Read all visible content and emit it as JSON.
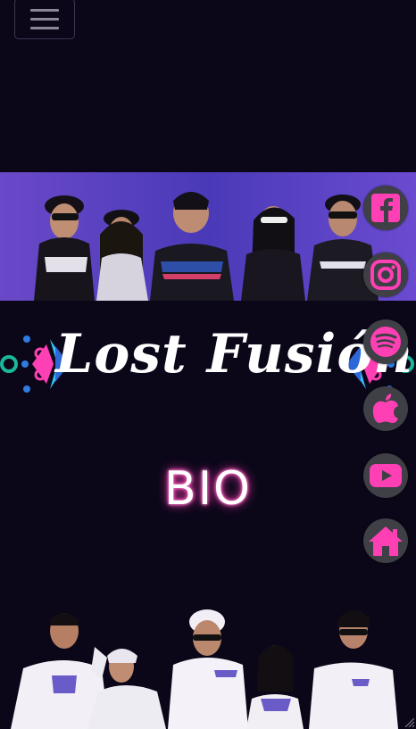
{
  "nav": {
    "menu_icon": "hamburger-icon"
  },
  "logo": {
    "text": "Lost Fusión"
  },
  "bio": {
    "heading": "BIO"
  },
  "social": [
    {
      "name": "facebook",
      "icon": "facebook-icon"
    },
    {
      "name": "instagram",
      "icon": "instagram-icon"
    },
    {
      "name": "spotify",
      "icon": "spotify-icon"
    },
    {
      "name": "apple-music",
      "icon": "apple-icon"
    },
    {
      "name": "youtube",
      "icon": "youtube-icon"
    },
    {
      "name": "home",
      "icon": "home-icon"
    }
  ],
  "colors": {
    "accent": "#ff3fb4",
    "background": "#0b0719",
    "button": "#3f3f46"
  }
}
